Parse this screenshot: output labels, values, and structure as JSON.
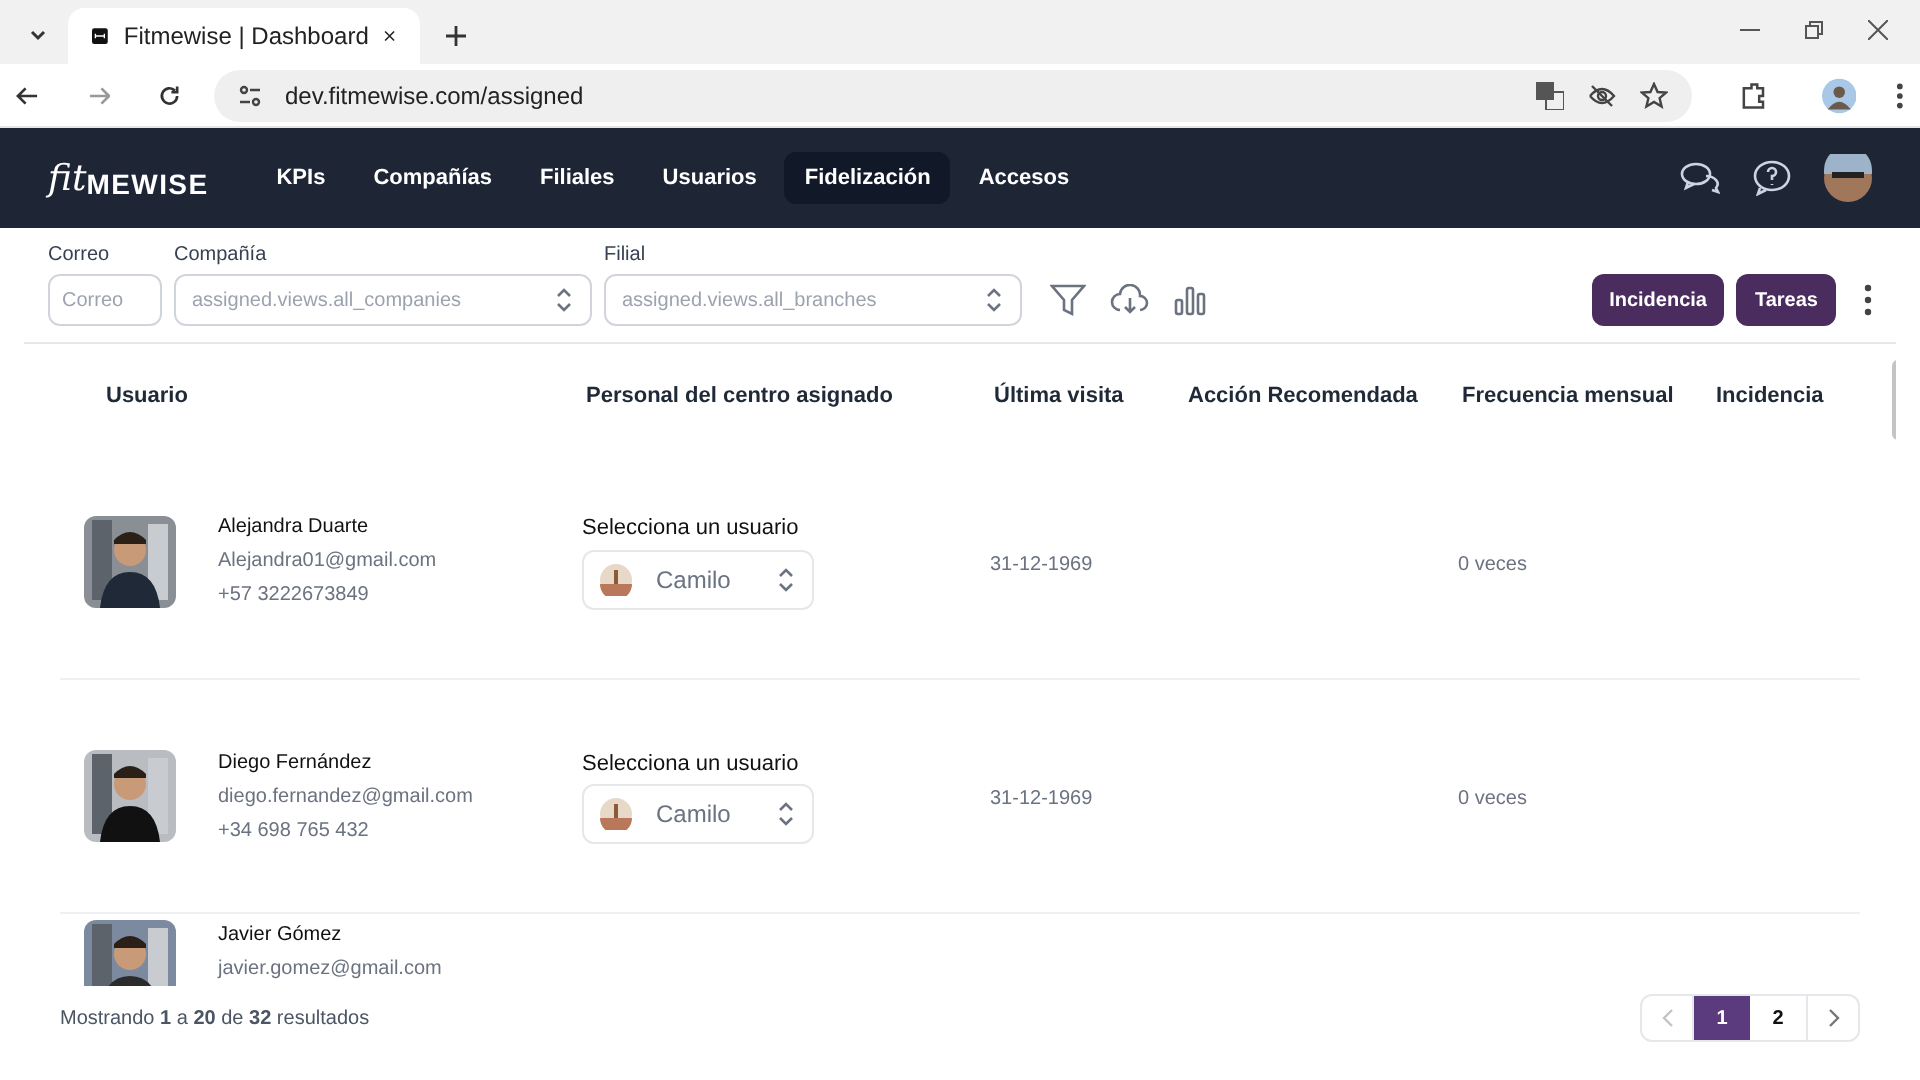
{
  "browser": {
    "tab_title": "Fitmewise | Dashboard",
    "url": "dev.fitmewise.com/assigned"
  },
  "nav": {
    "logo_script": "fit",
    "logo_text": "MEWISE",
    "items": [
      {
        "label": "KPIs",
        "selected": false
      },
      {
        "label": "Compañías",
        "selected": false
      },
      {
        "label": "Filiales",
        "selected": false
      },
      {
        "label": "Usuarios",
        "selected": false
      },
      {
        "label": "Fidelización",
        "selected": true
      },
      {
        "label": "Accesos",
        "selected": false
      }
    ]
  },
  "filters": {
    "email": {
      "label": "Correo",
      "placeholder": "Correo"
    },
    "company": {
      "label": "Compañía",
      "placeholder": "assigned.views.all_companies"
    },
    "branch": {
      "label": "Filial",
      "placeholder": "assigned.views.all_branches"
    },
    "buttons": [
      "Incidencia",
      "Tareas"
    ]
  },
  "table": {
    "columns": [
      "Usuario",
      "Personal del centro asignado",
      "Última visita",
      "Acción Recomendada",
      "Frecuencia mensual",
      "Incidencia"
    ],
    "rows": [
      {
        "name": "Alejandra Duarte",
        "email": "Alejandra01@gmail.com",
        "phone": "+57 3222673849",
        "staff_label": "Selecciona un usuario",
        "staff": "Camilo",
        "last_visit": "31-12-1969",
        "frequency": "0 veces"
      },
      {
        "name": "Diego Fernández",
        "email": "diego.fernandez@gmail.com",
        "phone": "+34 698 765 432",
        "staff_label": "Selecciona un usuario",
        "staff": "Camilo",
        "last_visit": "31-12-1969",
        "frequency": "0 veces"
      },
      {
        "name": "Javier Gómez",
        "email": "javier.gomez@gmail.com"
      }
    ]
  },
  "footer": {
    "summary": "Mostrando **1** a **20** de **32** resultados",
    "pages": [
      {
        "label": "1",
        "selected": true
      },
      {
        "label": "2",
        "selected": false
      }
    ]
  }
}
